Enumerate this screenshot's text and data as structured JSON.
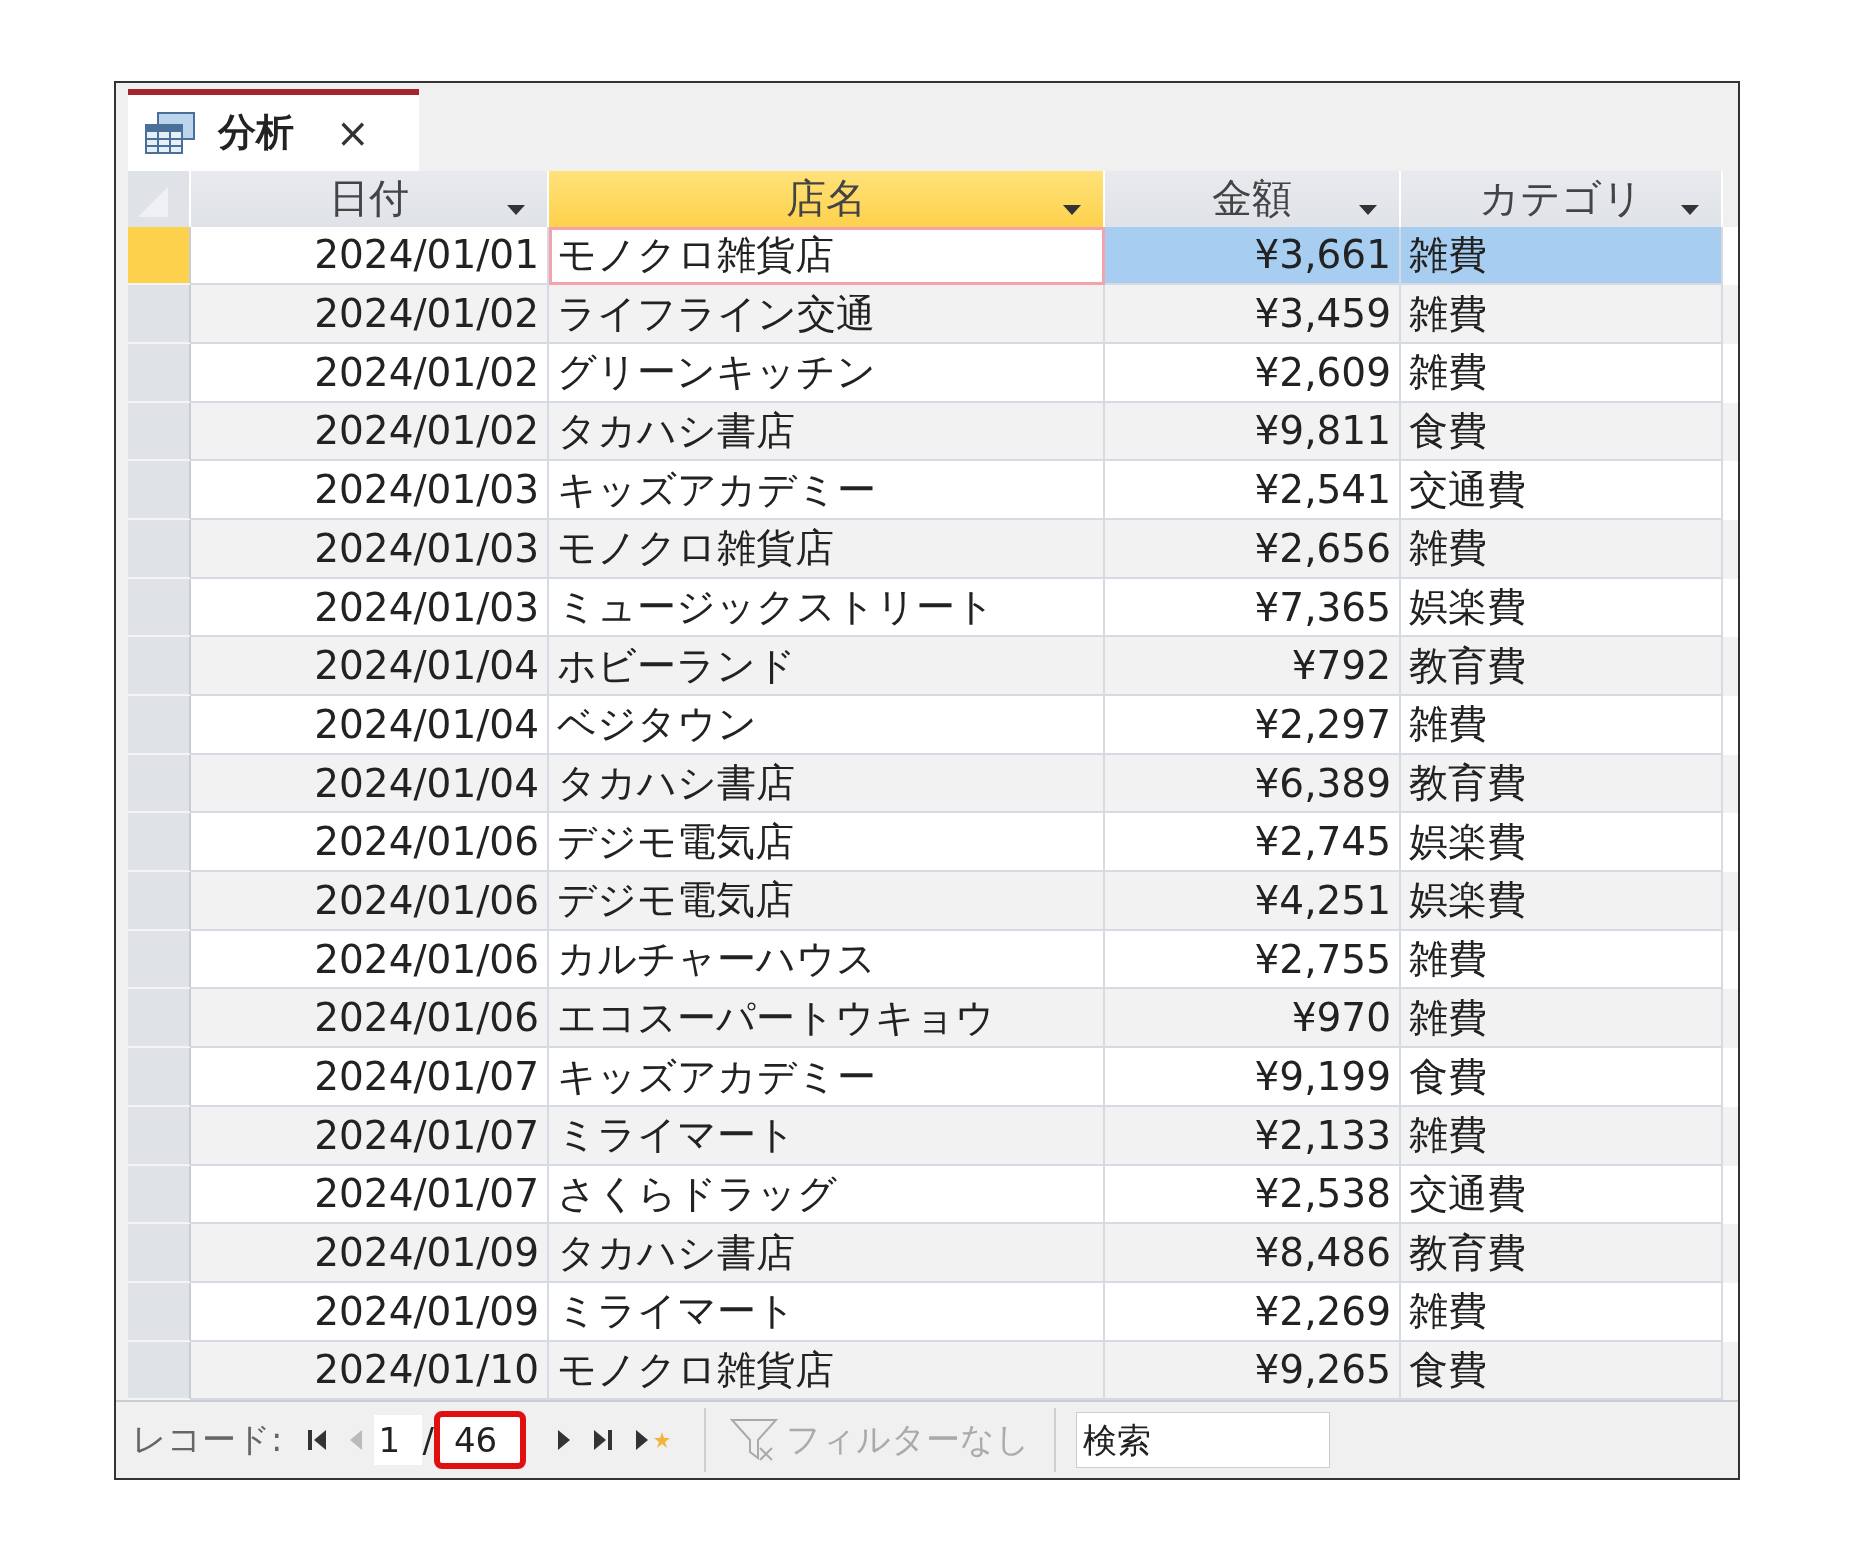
{
  "tab": {
    "title": "分析",
    "close": "×"
  },
  "columns": [
    {
      "label": "日付",
      "selected": false
    },
    {
      "label": "店名",
      "selected": true
    },
    {
      "label": "金額",
      "selected": false
    },
    {
      "label": "カテゴリ",
      "selected": false
    }
  ],
  "rows": [
    {
      "date": "2024/01/01",
      "shop": "モノクロ雑貨店",
      "amount": "¥3,661",
      "category": "雑費",
      "selected": true
    },
    {
      "date": "2024/01/02",
      "shop": "ライフライン交通",
      "amount": "¥3,459",
      "category": "雑費",
      "selected": false
    },
    {
      "date": "2024/01/02",
      "shop": "グリーンキッチン",
      "amount": "¥2,609",
      "category": "雑費",
      "selected": false
    },
    {
      "date": "2024/01/02",
      "shop": "タカハシ書店",
      "amount": "¥9,811",
      "category": "食費",
      "selected": false
    },
    {
      "date": "2024/01/03",
      "shop": "キッズアカデミー",
      "amount": "¥2,541",
      "category": "交通費",
      "selected": false
    },
    {
      "date": "2024/01/03",
      "shop": "モノクロ雑貨店",
      "amount": "¥2,656",
      "category": "雑費",
      "selected": false
    },
    {
      "date": "2024/01/03",
      "shop": "ミュージックストリート",
      "amount": "¥7,365",
      "category": "娯楽費",
      "selected": false
    },
    {
      "date": "2024/01/04",
      "shop": "ホビーランド",
      "amount": "¥792",
      "category": "教育費",
      "selected": false
    },
    {
      "date": "2024/01/04",
      "shop": "ベジタウン",
      "amount": "¥2,297",
      "category": "雑費",
      "selected": false
    },
    {
      "date": "2024/01/04",
      "shop": "タカハシ書店",
      "amount": "¥6,389",
      "category": "教育費",
      "selected": false
    },
    {
      "date": "2024/01/06",
      "shop": "デジモ電気店",
      "amount": "¥2,745",
      "category": "娯楽費",
      "selected": false
    },
    {
      "date": "2024/01/06",
      "shop": "デジモ電気店",
      "amount": "¥4,251",
      "category": "娯楽費",
      "selected": false
    },
    {
      "date": "2024/01/06",
      "shop": "カルチャーハウス",
      "amount": "¥2,755",
      "category": "雑費",
      "selected": false
    },
    {
      "date": "2024/01/06",
      "shop": "エコスーパートウキョウ",
      "amount": "¥970",
      "category": "雑費",
      "selected": false
    },
    {
      "date": "2024/01/07",
      "shop": "キッズアカデミー",
      "amount": "¥9,199",
      "category": "食費",
      "selected": false
    },
    {
      "date": "2024/01/07",
      "shop": "ミライマート",
      "amount": "¥2,133",
      "category": "雑費",
      "selected": false
    },
    {
      "date": "2024/01/07",
      "shop": "さくらドラッグ",
      "amount": "¥2,538",
      "category": "交通費",
      "selected": false
    },
    {
      "date": "2024/01/09",
      "shop": "タカハシ書店",
      "amount": "¥8,486",
      "category": "教育費",
      "selected": false
    },
    {
      "date": "2024/01/09",
      "shop": "ミライマート",
      "amount": "¥2,269",
      "category": "雑費",
      "selected": false
    },
    {
      "date": "2024/01/10",
      "shop": "モノクロ雑貨店",
      "amount": "¥9,265",
      "category": "食費",
      "selected": false
    }
  ],
  "navigation": {
    "label": "レコード:",
    "current": "1",
    "separator": "/",
    "total": "46",
    "total_highlighted": true,
    "prev_disabled": true,
    "filter": {
      "label": "フィルターなし",
      "disabled": true
    },
    "search": {
      "placeholder": "検索"
    }
  }
}
